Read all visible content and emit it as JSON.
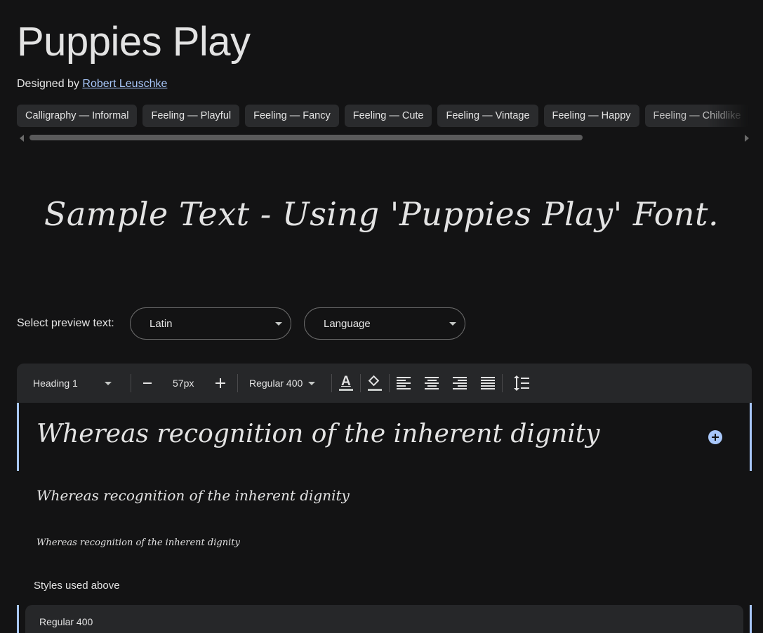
{
  "title": "Puppies Play",
  "designer": {
    "prefix": "Designed by",
    "name": "Robert Leuschke"
  },
  "tags": [
    "Calligraphy — Informal",
    "Feeling — Playful",
    "Feeling — Fancy",
    "Feeling — Cute",
    "Feeling — Vintage",
    "Feeling — Happy",
    "Feeling — Childlike"
  ],
  "sample_text": "Sample Text - Using 'Puppies Play' Font.",
  "preview": {
    "label": "Select preview text:",
    "script_value": "Latin",
    "language_value": "Language"
  },
  "toolbar": {
    "style": "Heading 1",
    "size": "57px",
    "weight": "Regular 400",
    "icons": [
      "minus-icon",
      "plus-icon",
      "font-color-icon",
      "fill-color-icon",
      "align-left-icon",
      "align-center-icon",
      "align-right-icon",
      "align-justify-icon",
      "line-height-icon"
    ]
  },
  "preview_lines": [
    "Whereas recognition of the inherent dignity",
    "Whereas recognition of the inherent dignity",
    "Whereas recognition of the inherent dignity"
  ],
  "styles_used_label": "Styles used above",
  "style_card_label": "Regular 400",
  "colors": {
    "accent": "#a8c7fa",
    "background": "#131314",
    "surface": "#262729"
  }
}
